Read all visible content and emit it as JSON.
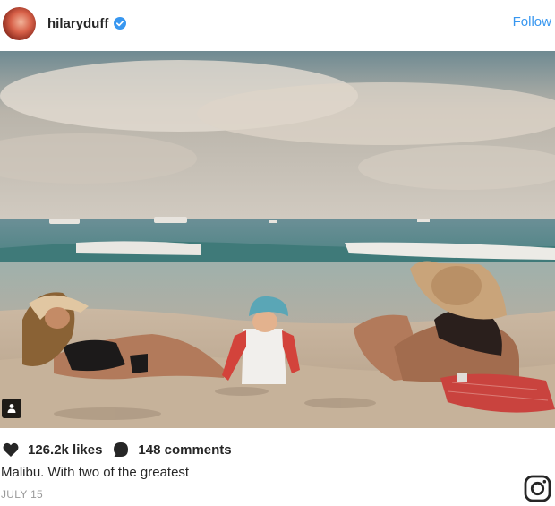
{
  "header": {
    "username": "hilaryduff",
    "follow_label": "Follow",
    "verified_icon": "verified-badge-icon",
    "accent_color": "#3897f0"
  },
  "photo": {
    "description_icon": "beach-photo"
  },
  "stats": {
    "likes": "126.2k likes",
    "comments": "148 comments"
  },
  "caption": "Malibu. With two of the greatest",
  "date": "JULY 15",
  "icons": {
    "heart": "heart-icon",
    "comment": "comment-icon",
    "user_tag": "user-tag-icon",
    "brand": "instagram-icon"
  }
}
